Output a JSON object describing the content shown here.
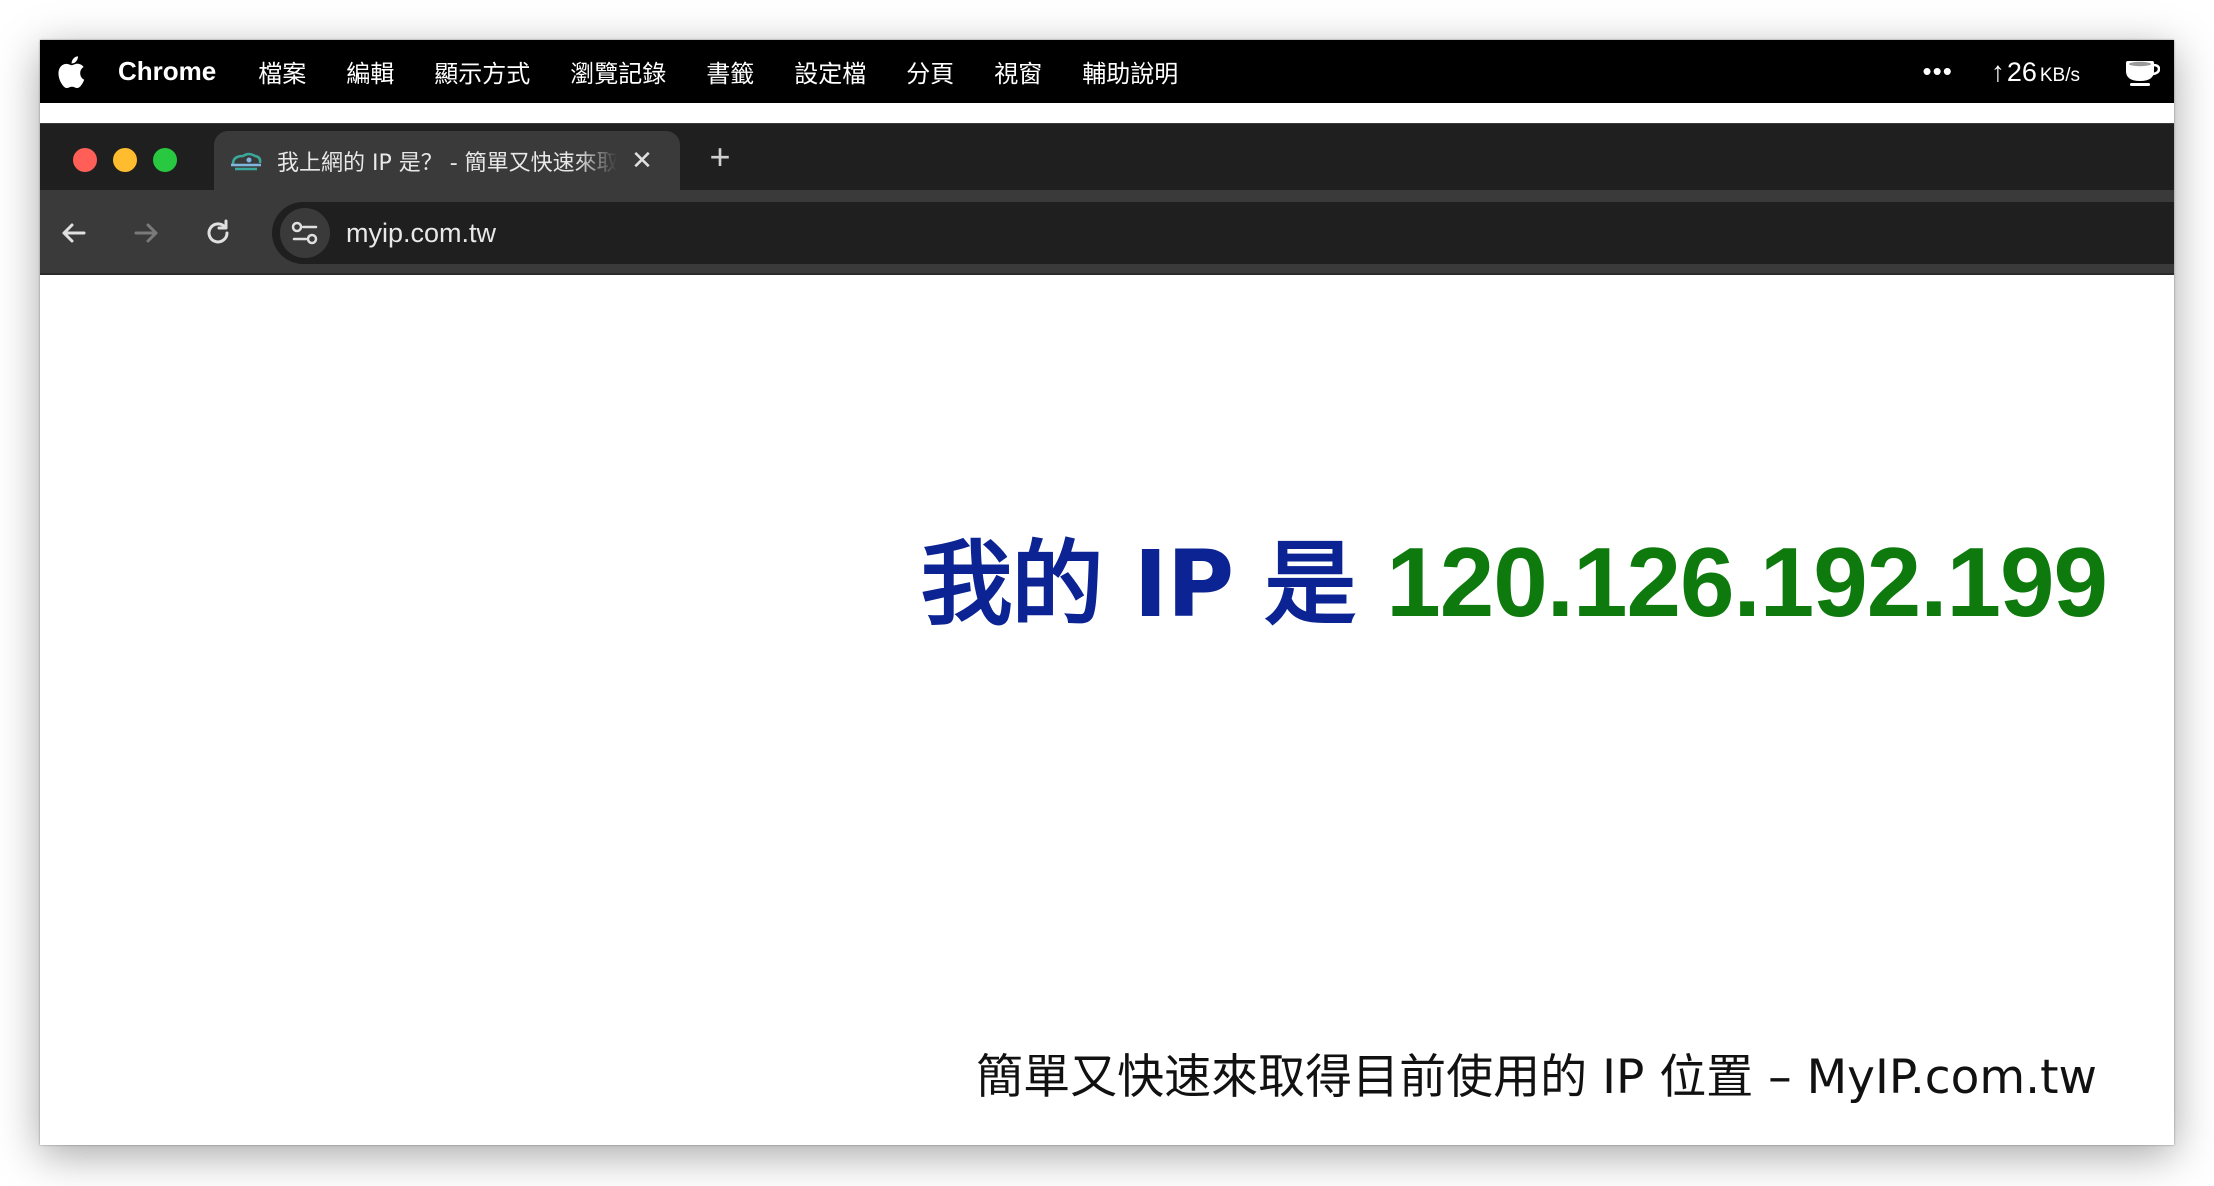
{
  "menubar": {
    "app_name": "Chrome",
    "items": [
      "檔案",
      "編輯",
      "顯示方式",
      "瀏覽記錄",
      "書籤",
      "設定檔",
      "分頁",
      "視窗",
      "輔助說明"
    ],
    "more_label": "•••",
    "network_arrow": "↑",
    "network_value": "26",
    "network_unit": "KB/s"
  },
  "browser": {
    "tab_title": "我上網的 IP 是？ - 簡單又快速來取得目前使用的 IP 位置",
    "tab_close": "✕",
    "new_tab": "+",
    "url": "myip.com.tw"
  },
  "page": {
    "headline_label": "我的 IP 是",
    "ip_address": "120.126.192.199",
    "subtitle": "簡單又快速來取得目前使用的 IP 位置 – MyIP.com.tw"
  },
  "colors": {
    "headline_label": "#0b2393",
    "ip_address": "#0e7a0d",
    "tl_red": "#ff5f57",
    "tl_yellow": "#febc2e",
    "tl_green": "#28c840"
  }
}
